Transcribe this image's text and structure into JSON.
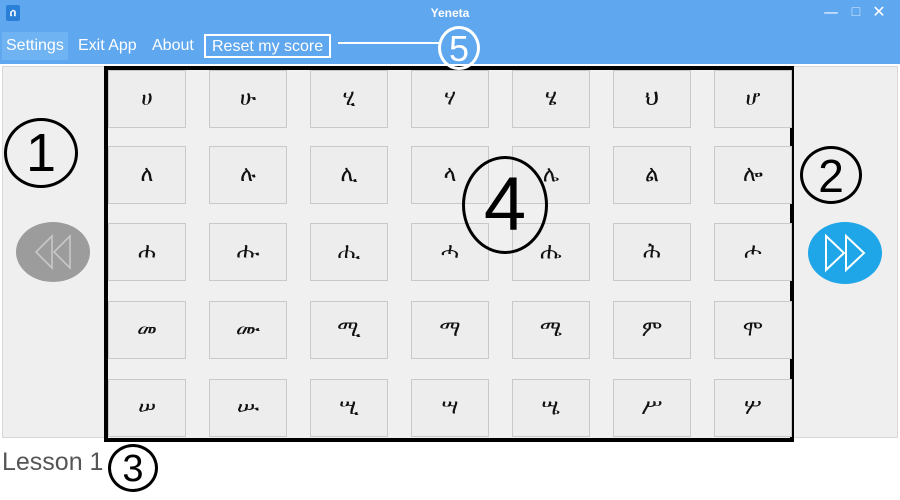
{
  "window": {
    "title": "Yeneta",
    "app_icon_glyph": "ሰ",
    "minimize_glyph": "—",
    "maximize_glyph": "☐",
    "close_glyph": "✕"
  },
  "menu": {
    "settings": "Settings",
    "exit": "Exit App",
    "about": "About",
    "reset": "Reset my score"
  },
  "grid": {
    "rows": [
      [
        "ሀ",
        "ሁ",
        "ሂ",
        "ሃ",
        "ሄ",
        "ህ",
        "ሆ"
      ],
      [
        "ለ",
        "ሉ",
        "ሊ",
        "ላ",
        "ሌ",
        "ል",
        "ሎ"
      ],
      [
        "ሐ",
        "ሑ",
        "ሒ",
        "ሓ",
        "ሔ",
        "ሕ",
        "ሖ"
      ],
      [
        "መ",
        "ሙ",
        "ሚ",
        "ማ",
        "ሜ",
        "ም",
        "ሞ"
      ],
      [
        "ሠ",
        "ሡ",
        "ሢ",
        "ሣ",
        "ሤ",
        "ሥ",
        "ሦ"
      ]
    ]
  },
  "nav": {
    "prev_icon": "rewind-icon",
    "next_icon": "fast-forward-icon",
    "prev_color": "#9c9c9c",
    "next_color": "#1ea6e8"
  },
  "lesson": {
    "label": "Lesson 1"
  },
  "annotations": {
    "a1": "1",
    "a2": "2",
    "a3": "3",
    "a4": "4",
    "a5": "5"
  },
  "colors": {
    "accent": "#5fa7ef",
    "panel": "#efefef"
  }
}
